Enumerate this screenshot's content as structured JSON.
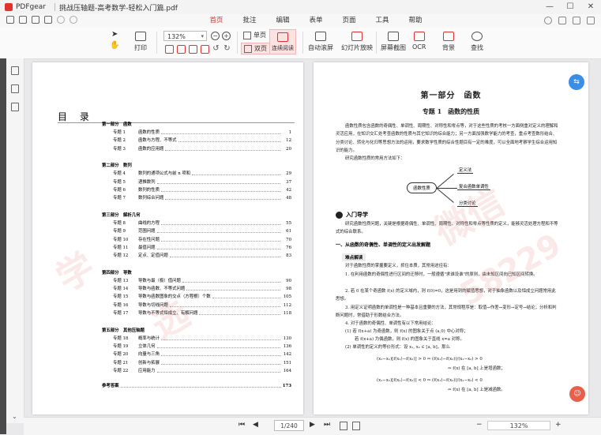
{
  "window": {
    "app_name": "PDFgear",
    "doc_title": "挑战压轴题-高考数学-轻松入门篇.pdf",
    "controls": {
      "minimize": "—",
      "maximize": "☐",
      "close": "✕"
    }
  },
  "menu": {
    "tabs": [
      "首页",
      "批注",
      "编辑",
      "表单",
      "页面",
      "工具",
      "帮助"
    ],
    "active_tab": "首页"
  },
  "ribbon": {
    "print": "打印",
    "zoom_value": "132%",
    "single_page": "单页",
    "double_page": "双页",
    "continuous": "连续阅读",
    "auto_scroll": "自动滚屏",
    "slideshow": "幻灯片放映",
    "screenshot": "屏幕截图",
    "ocr": "OCR",
    "background": "背景",
    "find": "查找"
  },
  "toc": {
    "title": "目 录",
    "parts": [
      {
        "name": "第一部分　函数",
        "items": [
          {
            "n": "专题 1",
            "t": "函数的性质",
            "p": "1"
          },
          {
            "n": "专题 2",
            "t": "函数与方程、不等式",
            "p": "12"
          },
          {
            "n": "专题 3",
            "t": "函数的应用题",
            "p": "20"
          }
        ]
      },
      {
        "name": "第二部分　数列",
        "items": [
          {
            "n": "专题 4",
            "t": "数列的通项公式与前 n 项和",
            "p": "29"
          },
          {
            "n": "专题 5",
            "t": "递推数列",
            "p": "37"
          },
          {
            "n": "专题 6",
            "t": "数列的性质",
            "p": "42"
          },
          {
            "n": "专题 7",
            "t": "数列综合问题",
            "p": "48"
          }
        ]
      },
      {
        "name": "第三部分　解析几何",
        "items": [
          {
            "n": "专题 8",
            "t": "曲线的方程",
            "p": "55"
          },
          {
            "n": "专题 9",
            "t": "范围问题",
            "p": "61"
          },
          {
            "n": "专题 10",
            "t": "存在性问题",
            "p": "70"
          },
          {
            "n": "专题 11",
            "t": "最值问题",
            "p": "76"
          },
          {
            "n": "专题 12",
            "t": "定点、定值问题",
            "p": "83"
          }
        ]
      },
      {
        "name": "第四部分　导数",
        "items": [
          {
            "n": "专题 13",
            "t": "导数与最（极）值问题",
            "p": "90"
          },
          {
            "n": "专题 14",
            "t": "导数与函数、不等式问题",
            "p": "98"
          },
          {
            "n": "专题 15",
            "t": "导数与函数图象的交点（方程根）个数",
            "p": "105"
          },
          {
            "n": "专题 16",
            "t": "导数与切线问题",
            "p": "112"
          },
          {
            "n": "专题 17",
            "t": "导数与不等式恒成立、有解问题",
            "p": "118"
          }
        ]
      },
      {
        "name": "第五部分　其他压轴题",
        "items": [
          {
            "n": "专题 18",
            "t": "概率与统计",
            "p": "130"
          },
          {
            "n": "专题 19",
            "t": "立体几何",
            "p": "136"
          },
          {
            "n": "专题 20",
            "t": "向量与三角",
            "p": "142"
          },
          {
            "n": "专题 21",
            "t": "创新与拓展",
            "p": "151"
          },
          {
            "n": "专题 22",
            "t": "应用能力",
            "p": "164"
          }
        ]
      }
    ],
    "answers": {
      "label": "参考答案",
      "p": "173"
    }
  },
  "right_page": {
    "part_title": "第一部分　函数",
    "topic_title": "专题 1　函数的性质",
    "intro": "函数性质包含函数的奇偶性、单调性、周期性、对称性和零点等，对于这些性质的考核一方面侧重对定义的理解和灵活应用，在知识交汇处考查函数的性质与其它知识的综合能力；另一方面加强数学能力的考查，重点考查数形结合、分类讨论、转化与化归等思想方法的运用，要求数学性质的综合性题目有一定的难度，可以全面地考察学生综合运用知识的能力。",
    "intro2": "研究函数性质的常用方法如下：",
    "mindmap": {
      "root": "函数性质",
      "leaves": [
        "定义法",
        "复合函数单调性",
        "分类讨论"
      ]
    },
    "section_entry": "入门导学",
    "entry_text": "研究函数性质问题，关键是根据奇偶性、单调性、周期性、对称性和零点等性质的定义，能够灵活处理方程和不等式的综合联系。",
    "sub1": "一、从函数的奇偶性、单调性的定义出发解题",
    "tag": "难点解读",
    "p1": "对于函数性质的掌握要定义，抓住本质，其常用途径有：",
    "p2": "1. 在利用函数的奇偶性进行区间的迁移时，一般遵循\"求谁设谁\"的原则，由未知区间向已知区间转换。",
    "p3": "2. 若 0 在某个奇函数 f(x) 的定义域内，则 f(0)=0，这是用到的赋值思想，对于抽象函数以及恒成立问题常用此思想。",
    "p4": "3. 用定义证明函数的单调性是一种基本且重要的方法，其常规程序是：取值→作差→变形→定号→结论；分析和判断问题时，常借助于形数结合方法。",
    "p5": "4. 对于函数的奇偶性、单调性有以下常用结论：",
    "p6": "(1) 若 f(x+a) 为奇函数，则 f(x) 的图象关于点 (a,0) 中心对称；",
    "p7": "若 f(x+a) 为偶函数，则 f(x) 的图象关于直线 x=a 对称。",
    "p8": "(2) 单调性的定义的等价形式：设 x₁, x₂ ∈ [a, b]，那么",
    "f1": "(x₁−x₂)[f(x₁)−f(x₂)] > 0 ⇔ (f(x₁)−f(x₂))/(x₁−x₂) > 0",
    "f1b": "⇔ f(x) 在 [a, b] 上是增函数；",
    "f2": "(x₁−x₂)[f(x₁)−f(x₂)] < 0 ⇔ (f(x₁)−f(x₂))/(x₁−x₂) < 0",
    "f2b": "⇔ f(x) 在 [a, b] 上是减函数。"
  },
  "watermarks": [
    "学",
    "微信",
    "选",
    "58229"
  ],
  "statusbar": {
    "page_display": "1/240",
    "zoom": "132%",
    "zoom_minus": "−",
    "zoom_plus": "+"
  }
}
